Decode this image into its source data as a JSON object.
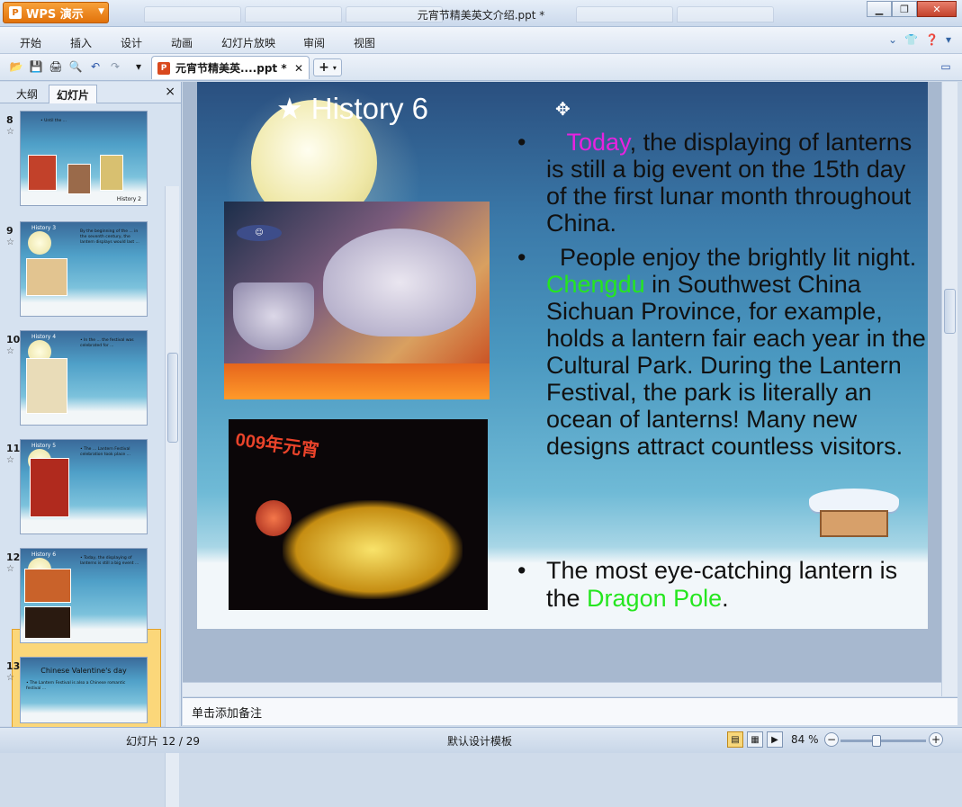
{
  "app": {
    "name": "WPS 演示",
    "window_title": "元宵节精美英文介绍.ppt *"
  },
  "menu": {
    "items": [
      "开始",
      "插入",
      "设计",
      "动画",
      "幻灯片放映",
      "审阅",
      "视图"
    ]
  },
  "toolbar": {
    "doc_tab": "元宵节精美英....ppt *",
    "new_tab": "+"
  },
  "panel": {
    "tab_outline": "大纲",
    "tab_slides": "幻灯片",
    "close": "×"
  },
  "thumbnails": [
    {
      "num": "8",
      "title": "",
      "caption": "History 2"
    },
    {
      "num": "9",
      "title": "History 3",
      "caption": ""
    },
    {
      "num": "10",
      "title": "History 4",
      "caption": ""
    },
    {
      "num": "11",
      "title": "History 5",
      "caption": ""
    },
    {
      "num": "12",
      "title": "History 6",
      "caption": ""
    },
    {
      "num": "13",
      "title": "Chinese Valentine's day",
      "caption": ""
    }
  ],
  "slide": {
    "title": "History 6",
    "b1_hl": "Today",
    "b1_rest": ", the displaying of lanterns is still a big event on the 15th day of the first lunar month throughout China.",
    "b2_pre": "People enjoy the brightly lit night. ",
    "b2_hl": "Chengdu",
    "b2_rest": " in Southwest China  Sichuan Province, for example, holds a lantern fair each year in the Cultural Park. During the Lantern Festival, the park is literally an ocean of lanterns! Many new designs attract countless visitors.",
    "b3_pre": "The most eye-catching lantern is the ",
    "b3_hl": "Dragon Pole",
    "b3_post": ".",
    "img2_banner": "009年元宵",
    "colors": {
      "highlight_pink": "#e722e0",
      "highlight_green": "#25e61f"
    }
  },
  "notes": {
    "placeholder": "单击添加备注"
  },
  "status": {
    "slide_info": "幻灯片 12 / 29",
    "template": "默认设计模板",
    "zoom": "84 %"
  }
}
